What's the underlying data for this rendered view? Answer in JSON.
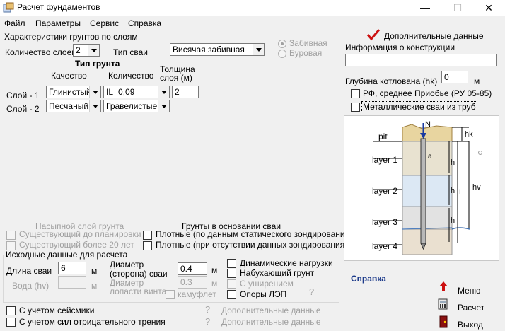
{
  "window": {
    "title": "Расчет фундаментов",
    "minimize": "—",
    "maximize": "☐",
    "close": "✕"
  },
  "menu": [
    "Файл",
    "Параметры",
    "Сервис",
    "Справка"
  ],
  "soil": {
    "group_title": "Характеристики грунтов по слоям",
    "layers_count_label": "Количество слоев",
    "layers_count_value": "2",
    "pile_type_label": "Тип сваи",
    "pile_type_value": "Висячая забивная",
    "radio_driven": "Забивная",
    "radio_bored": "Буровая",
    "soil_type_header": "Тип грунта",
    "col_quality": "Качество",
    "col_quantity": "Количество",
    "col_thickness": "Толщина слоя (м)",
    "layers": [
      {
        "label": "Слой - 1",
        "quality": "Глинистый",
        "quantity": "IL=0,09",
        "thickness": "2"
      },
      {
        "label": "Слой - 2",
        "quality": "Песчаный",
        "quantity": "Гравелистые",
        "thickness": ""
      }
    ]
  },
  "fill": {
    "title": "Насыпной слой грунта",
    "opt1": "Существующий до планировки",
    "opt2": "Существующий более 20 лет"
  },
  "base": {
    "title": "Грунты в основании сваи",
    "opt1": "Плотные (по данным статического зондирования)",
    "opt2": "Плотные (при отсутствии данных зондирования)"
  },
  "input": {
    "group_title": "Исходные данные для расчета",
    "pile_length_label": "Длина сваи",
    "pile_length_value": "6",
    "water_label": "Вода (hv)",
    "unit_m": "м",
    "diameter_label_1": "Диаметр",
    "diameter_label_2": "(сторона) сваи",
    "diameter_value": "0.4",
    "blade_label_1": "Диаметр",
    "blade_label_2": "лопасти винта",
    "blade_value": "0.3",
    "camouflet": "камуфлет",
    "dynamic": "Динамические нагрузки",
    "swelling": "Набухающий грунт",
    "widening": "С уширением",
    "power_line": "Опоры ЛЭП",
    "q": "?"
  },
  "bottom": {
    "seismic": "С учетом сейсмики",
    "negative_friction": "С учетом сил отрицательного трения",
    "extra1": "Дополнительные данные",
    "extra2": "Дополнительные данные"
  },
  "right": {
    "extra_data": "Дополнительные данные",
    "construction_info": "Информация о конструкции",
    "pit_depth_label": "Глубина котлована (hk)",
    "pit_depth_value": "0",
    "unit_m": "м",
    "rf_label": "РФ, среднее Приобье (РУ 05-85)",
    "metal_piles": "Металлические сваи из труб"
  },
  "diagram": {
    "pit": "pit",
    "layer1": "layer 1",
    "layer2": "layer 2",
    "layer3": "layer 3",
    "layer4": "layer 4",
    "N": "N",
    "hk": "hk",
    "hv": "hv",
    "h": "h",
    "L": "L",
    "a": "a"
  },
  "help": "Справка",
  "actions": {
    "menu": "Меню",
    "calc": "Расчет",
    "exit": "Выход"
  },
  "colors": {
    "accent_red": "#cc1010",
    "help_blue": "#1c3a8a"
  }
}
